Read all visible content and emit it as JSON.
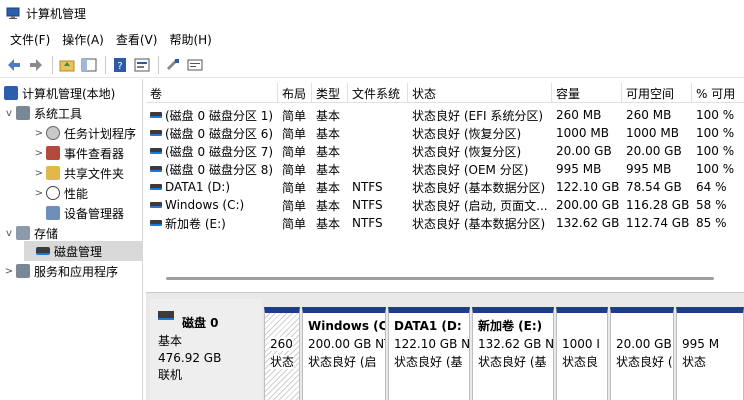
{
  "window": {
    "title": "计算机管理"
  },
  "menu": [
    "文件(F)",
    "操作(A)",
    "查看(V)",
    "帮助(H)"
  ],
  "toolbar": {
    "buttons": [
      "back-icon",
      "forward-icon",
      "folder-up-icon",
      "show-hide-tree-icon",
      "help-icon",
      "properties-icon",
      "connect-icon",
      "console-icon"
    ]
  },
  "tree": {
    "root": "计算机管理(本地)",
    "items": [
      {
        "label": "系统工具",
        "level": 1,
        "expander": "v"
      },
      {
        "label": "任务计划程序",
        "level": 2,
        "expander": ">"
      },
      {
        "label": "事件查看器",
        "level": 2,
        "expander": ">"
      },
      {
        "label": "共享文件夹",
        "level": 2,
        "expander": ">"
      },
      {
        "label": "性能",
        "level": 2,
        "expander": ">"
      },
      {
        "label": "设备管理器",
        "level": 2,
        "expander": ""
      },
      {
        "label": "存储",
        "level": 1,
        "expander": "v"
      },
      {
        "label": "磁盘管理",
        "level": 2,
        "expander": "",
        "selected": true
      },
      {
        "label": "服务和应用程序",
        "level": 1,
        "expander": ">"
      }
    ]
  },
  "volume_table": {
    "columns": [
      "卷",
      "布局",
      "类型",
      "文件系统",
      "状态",
      "容量",
      "可用空间",
      "% 可用"
    ],
    "rows": [
      [
        "(磁盘 0 磁盘分区 1)",
        "简单",
        "基本",
        "",
        "状态良好 (EFI 系统分区)",
        "260 MB",
        "260 MB",
        "100 %"
      ],
      [
        "(磁盘 0 磁盘分区 6)",
        "简单",
        "基本",
        "",
        "状态良好 (恢复分区)",
        "1000 MB",
        "1000 MB",
        "100 %"
      ],
      [
        "(磁盘 0 磁盘分区 7)",
        "简单",
        "基本",
        "",
        "状态良好 (恢复分区)",
        "20.00 GB",
        "20.00 GB",
        "100 %"
      ],
      [
        "(磁盘 0 磁盘分区 8)",
        "简单",
        "基本",
        "",
        "状态良好 (OEM 分区)",
        "995 MB",
        "995 MB",
        "100 %"
      ],
      [
        "DATA1 (D:)",
        "简单",
        "基本",
        "NTFS",
        "状态良好 (基本数据分区)",
        "122.10 GB",
        "78.54 GB",
        "64 %"
      ],
      [
        "Windows (C:)",
        "简单",
        "基本",
        "NTFS",
        "状态良好 (启动, 页面文...",
        "200.00 GB",
        "116.28 GB",
        "58 %"
      ],
      [
        "新加卷 (E:)",
        "简单",
        "基本",
        "NTFS",
        "状态良好 (基本数据分区)",
        "132.62 GB",
        "112.74 GB",
        "85 %"
      ]
    ]
  },
  "disk": {
    "name": "磁盘 0",
    "type": "基本",
    "size": "476.92 GB",
    "status": "联机"
  },
  "partitions": [
    {
      "name": "",
      "size": "260",
      "status": "状态"
    },
    {
      "name": "Windows (C",
      "size": "200.00 GB NT",
      "status": "状态良好 (启"
    },
    {
      "name": "DATA1 (D:",
      "size": "122.10 GB NT",
      "status": "状态良好 (基"
    },
    {
      "name": "新加卷 (E:)",
      "size": "132.62 GB NT",
      "status": "状态良好 (基"
    },
    {
      "name": "",
      "size": "1000 I",
      "status": "状态良"
    },
    {
      "name": "",
      "size": "20.00 GB",
      "status": "状态良好 ("
    },
    {
      "name": "",
      "size": "995 M",
      "status": "状态"
    }
  ],
  "colors": {
    "partition_header": "#1f3a93",
    "selected_tree": "#d9d9d9",
    "volume_icon_accent": "#1e78d6"
  }
}
